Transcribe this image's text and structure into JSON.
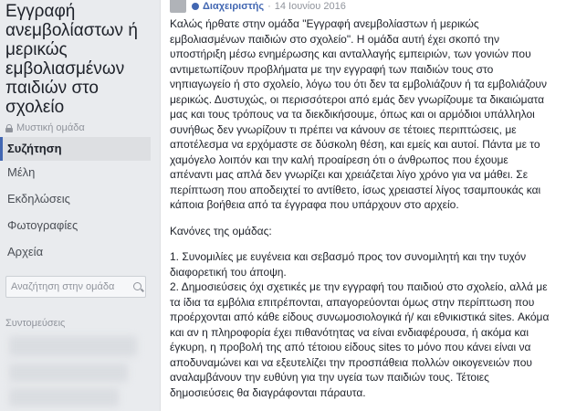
{
  "sidebar": {
    "group_name": "Εγγραφή ανεμβολίαστων ή μερικώς εμβολιασμένων παιδιών στο σχολείο",
    "privacy_label": "Μυστική ομάδα",
    "items": [
      {
        "label": "Συζήτηση",
        "active": true
      },
      {
        "label": "Μέλη"
      },
      {
        "label": "Εκδηλώσεις"
      },
      {
        "label": "Φωτογραφίες"
      },
      {
        "label": "Αρχεία"
      }
    ],
    "search": {
      "placeholder": "Αναζήτηση στην ομάδα"
    },
    "shortcuts_label": "Συντομεύσεις"
  },
  "post": {
    "author_label": "Διαχειριστής",
    "separator": "·",
    "date": "14 Ιουνίου 2016",
    "intro": "Καλώς ήρθατε στην ομάδα \"Εγγραφή ανεμβολίαστων ή μερικώς εμβολιασμένων παιδιών στο σχολείο\". Η ομάδα αυτή έχει σκοπό την υποστήριξη μέσω ενημέρωσης και ανταλλαγής εμπειριών, των γονιών που αντιμετωπίζουν προβλήματα με την εγγραφή των παιδιών τους στο νηπιαγωγείο ή στο σχολείο, λόγω του ότι δεν τα εμβολιάζουν ή τα εμβολιάζουν μερικώς. Δυστυχώς, οι περισσότεροι από εμάς δεν γνωρίζουμε τα δικαιώματα μας και τους τρόπους να τα διεκδικήσουμε, όπως και οι αρμόδιοι υπάλληλοι συνήθως δεν γνωρίζουν τι πρέπει να κάνουν σε τέτοιες περιπτώσεις, με αποτέλεσμα να ερχόμαστε σε δύσκολη θέση, και εμείς και αυτοί. Πάντα με το χαμόγελο λοιπόν και την καλή προαίρεση ότι ο άνθρωπος που έχουμε απέναντι μας απλά δεν γνωρίζει και χρειάζεται λίγο χρόνο για να μάθει. Σε περίπτωση που αποδειχτεί το αντίθετο, ίσως χρειαστεί λίγος τσαμπουκάς και κάποια βοήθεια από τα έγγραφα που υπάρχουν στο αρχείο.",
    "rules_heading": "Κανόνες της ομάδας:",
    "rule1": "1. Συνομιλίες με ευγένεια και σεβασμό προς τον συνομιλητή και την τυχόν διαφορετική του άποψη.",
    "rule2": "2. Δημοσιεύσεις όχι σχετικές με την εγγραφή του παιδιού στο σχολείο, αλλά με τα ίδια τα εμβόλια επιτρέπονται, απαγορεύονται όμως στην περίπτωση που προέρχονται από κάθε είδους συνωμοσιολογικά ή/ και εθνικιστικά sites. Ακόμα και αν η πληροφορία έχει πιθανότητας να είναι ενδιαφέρουσα, ή ακόμα και έγκυρη, η προβολή της από τέτοιου είδους sites το μόνο που κάνει είναι να αποδυναμώνει και να εξευτελίζει την προσπάθεια πολλών οικογενειών που αναλαμβάνουν την ευθύνη για την υγεία των παιδιών τους. Τέτοιες δημοσιεύσεις θα διαγράφονται πάραυτα."
  },
  "colors": {
    "accent": "#4267b2",
    "background": "#e9ebee",
    "muted": "#90949c"
  }
}
